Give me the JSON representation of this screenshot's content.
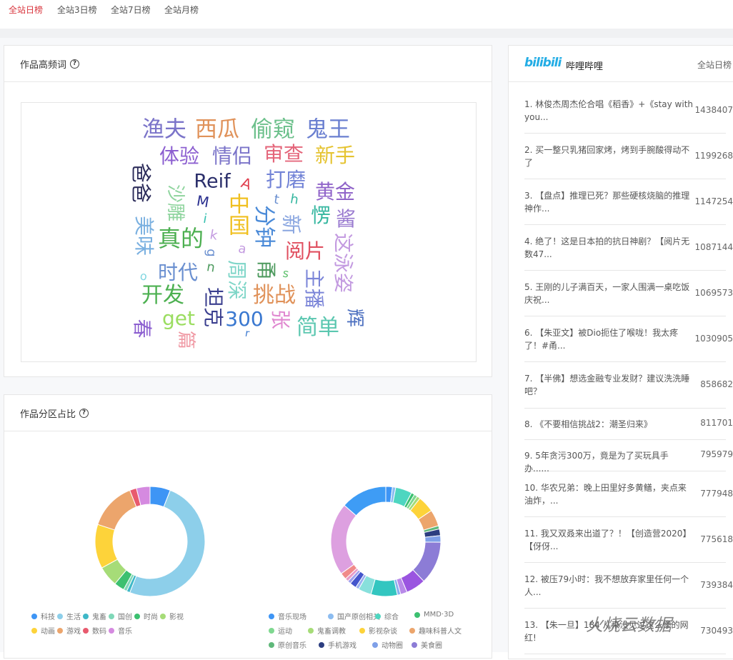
{
  "tabs": [
    "全站日榜",
    "全站3日榜",
    "全站7日榜",
    "全站月榜"
  ],
  "active_tab": 0,
  "word_card": {
    "title": "作品高频词",
    "help": "?"
  },
  "word_cloud": {
    "words": [
      "渔夫",
      "西瓜",
      "偷窥",
      "鬼王",
      "体验",
      "情侣",
      "审查",
      "新手",
      "爸爸",
      "Reif",
      "A",
      "打磨",
      "黄金",
      "沙雕",
      "M",
      "t",
      "h",
      "中国",
      "分钟",
      "新",
      "愣",
      "酱",
      "美味",
      "i",
      "k",
      "真的",
      "阅片",
      "这泳姿",
      "a",
      "g",
      "u",
      "时代",
      "周深",
      "甬",
      "s",
      "o",
      "主播",
      "开发",
      "坦克",
      "挑战",
      "300",
      "r",
      "张",
      "简单",
      "辉",
      "春",
      "get",
      "篇"
    ]
  },
  "pie_card": {
    "title": "作品分区占比",
    "help": "?"
  },
  "chart_data": [
    {
      "type": "pie",
      "variant": "donut",
      "categories": [
        "科技",
        "生活",
        "鬼畜",
        "国创",
        "时尚",
        "影视",
        "动画",
        "游戏",
        "数码",
        "音乐"
      ],
      "values": [
        6,
        50,
        1,
        1,
        3,
        6,
        13,
        14,
        2,
        4
      ],
      "colors": [
        "#3e95f5",
        "#8dcfea",
        "#3fb8c8",
        "#7fd8b8",
        "#3cc070",
        "#a6dc78",
        "#fdd33a",
        "#eca56c",
        "#e85a6e",
        "#d58ae0"
      ],
      "legend_placement": "bottom"
    },
    {
      "type": "pie",
      "variant": "donut",
      "categories": [
        "音乐现场",
        "国产原创相关",
        "综合",
        "MMD·3D",
        "运动",
        "鬼畜调教",
        "影视杂谈",
        "趣味科普人文",
        "原创音乐",
        "手机游戏",
        "动物圈",
        "美食圈"
      ],
      "values": [
        2,
        1,
        5,
        1,
        1,
        1,
        5,
        5,
        1,
        2,
        2,
        13
      ],
      "extra_values": [
        6,
        2,
        1,
        8,
        4,
        1,
        2,
        1,
        1,
        2,
        22,
        14
      ],
      "colors": [
        "#3e95f5",
        "#8cbcf0",
        "#4ed6c0",
        "#3cc070",
        "#7fd890",
        "#a6dc78",
        "#fdd33a",
        "#eca56c",
        "#5fb87a",
        "#2c3e80",
        "#7fa0e8",
        "#8c7cd6"
      ],
      "extra_colors": [
        "#9a55e0",
        "#b88ae8",
        "#8ab0f0",
        "#33c6c0",
        "#88e0dc",
        "#9ab0f0",
        "#4455cc",
        "#a0a0ee",
        "#e89ac8",
        "#f08a8a",
        "#dda0e0",
        "#3e9cf5"
      ],
      "legend_placement": "bottom"
    }
  ],
  "ranking": {
    "logo": "bilibili",
    "title": "哔哩哔哩",
    "subtitle": "全站日榜",
    "items": [
      {
        "title": "1. 林俊杰周杰伦合唱《稻香》+《stay with you...",
        "count": "1438407"
      },
      {
        "title": "2. 买一整只乳猪回家烤，烤到手腕酸得动不了",
        "count": "1199268"
      },
      {
        "title": "3. 【盘点】推理已死？那些硬核烧脑的推理神作...",
        "count": "1147254"
      },
      {
        "title": "4. 绝了！这是日本拍的抗日神剧？【阅片无数47...",
        "count": "1087144"
      },
      {
        "title": "5. 王刚的儿子满百天，一家人围满一桌吃饭庆祝...",
        "count": "1069573"
      },
      {
        "title": "6. 【朱亚文】被Dio扼住了喉咙！我太疼了！#甬...",
        "count": "1030905"
      },
      {
        "title": "7. 【半佛】想选金融专业发财？建议洗洗睡吧？",
        "count": "858682"
      },
      {
        "title": "8. 《不要相信挑战2：潮圣归来》",
        "count": "811701"
      },
      {
        "title": "9. 5年贪污300万，竟是为了买玩具手办......",
        "count": "795979"
      },
      {
        "title": "10. 华农兄弟：晚上田里好多黄鳝，夹点来油炸，...",
        "count": "777948"
      },
      {
        "title": "11. 我又双叒来出道了？！【创造营2020】【伢伢...",
        "count": "775618"
      },
      {
        "title": "12. 被压79小时：我不想放弃家里任何一个人...",
        "count": "739384"
      },
      {
        "title": "13. 【朱一旦】184 从来没见过这么惨的网红!",
        "count": "730493"
      }
    ]
  },
  "watermark": "火烧云数据"
}
